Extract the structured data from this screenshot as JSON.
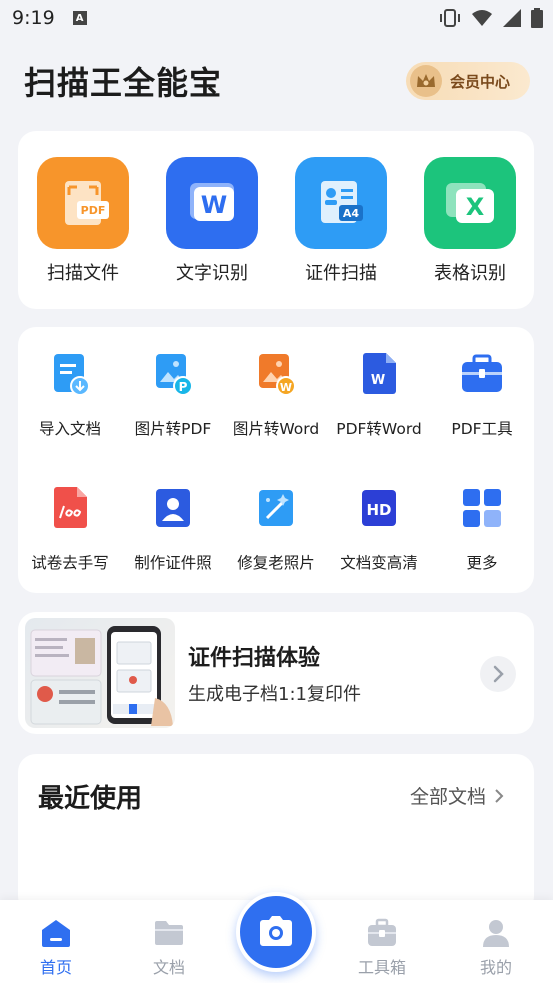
{
  "status_bar": {
    "time": "9:19",
    "a_badge": "A"
  },
  "header": {
    "title": "扫描王全能宝",
    "vip_label": "会员中心"
  },
  "main_features": [
    {
      "label": "扫描文件",
      "icon": "scan-file-icon",
      "color": "#f7952b",
      "badge": "PDF"
    },
    {
      "label": "文字识别",
      "icon": "word-ocr-icon",
      "color": "#2e6ef0",
      "badge": "W"
    },
    {
      "label": "证件扫描",
      "icon": "id-scan-icon",
      "color": "#2e9cf5",
      "badge": "A4"
    },
    {
      "label": "表格识别",
      "icon": "table-ocr-icon",
      "color": "#1cc47c",
      "badge": "X"
    }
  ],
  "tools": [
    {
      "label": "导入文档",
      "icon": "import-doc-icon"
    },
    {
      "label": "图片转PDF",
      "icon": "image-to-pdf-icon",
      "badge": "P"
    },
    {
      "label": "图片转Word",
      "icon": "image-to-word-icon",
      "badge": "W"
    },
    {
      "label": "PDF转Word",
      "icon": "pdf-to-word-icon",
      "badge": "W"
    },
    {
      "label": "PDF工具",
      "icon": "pdf-tools-icon"
    },
    {
      "label": "试卷去手写",
      "icon": "remove-handwriting-icon"
    },
    {
      "label": "制作证件照",
      "icon": "id-photo-icon"
    },
    {
      "label": "修复老照片",
      "icon": "restore-photo-icon"
    },
    {
      "label": "文档变高清",
      "icon": "hd-doc-icon",
      "badge": "HD"
    },
    {
      "label": "更多",
      "icon": "more-grid-icon"
    }
  ],
  "banner": {
    "title": "证件扫描体验",
    "subtitle": "生成电子档1:1复印件"
  },
  "recent": {
    "title": "最近使用",
    "all_docs": "全部文档"
  },
  "tabbar": [
    {
      "label": "首页",
      "icon": "home-icon",
      "active": true
    },
    {
      "label": "文档",
      "icon": "folder-icon",
      "active": false
    },
    {
      "label": "工具箱",
      "icon": "toolbox-icon",
      "active": false
    },
    {
      "label": "我的",
      "icon": "profile-icon",
      "active": false
    }
  ],
  "colors": {
    "accent": "#2f6ff0",
    "background": "#f2f3f7",
    "vip_gold": "#e9c08a"
  }
}
